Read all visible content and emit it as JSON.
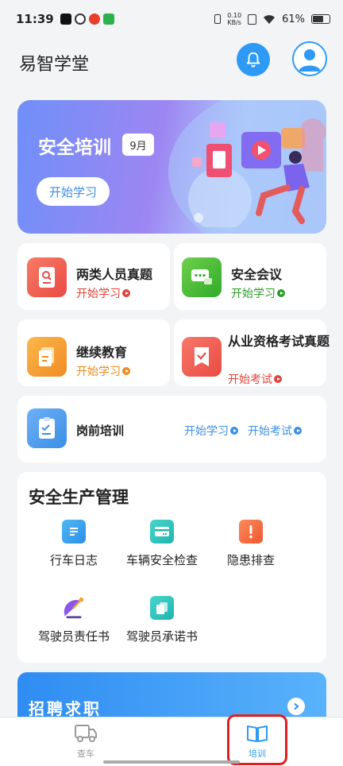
{
  "status_bar": {
    "time": "11:39",
    "net_speed_value": "0.10",
    "net_speed_unit": "KB/s",
    "battery": "61%"
  },
  "header": {
    "app_title": "易智学堂"
  },
  "banner": {
    "title": "安全培训",
    "month_badge": "9月",
    "button_label": "开始学习"
  },
  "cards": [
    {
      "title": "两类人员真题",
      "action": "开始学习",
      "color": "#f0574a"
    },
    {
      "title": "安全会议",
      "action": "开始学习",
      "color": "#3fb82c"
    },
    {
      "title": "继续教育",
      "action": "开始学习",
      "color": "#f59a2c"
    },
    {
      "title": "从业资格考试真题",
      "action": "开始考试",
      "color": "#ef5a4c"
    }
  ],
  "pre_job": {
    "title": "岗前培训",
    "action_study": "开始学习",
    "action_exam": "开始考试",
    "color": "#3a8fe6"
  },
  "safety_section": {
    "title": "安全生产管理",
    "tools": [
      {
        "label": "行车日志",
        "icon": "log-icon"
      },
      {
        "label": "车辆安全检查",
        "icon": "vehicle-check-icon"
      },
      {
        "label": "隐患排查",
        "icon": "hazard-icon"
      },
      {
        "label": "驾驶员责任书",
        "icon": "responsibility-icon"
      },
      {
        "label": "驾驶员承诺书",
        "icon": "pledge-icon"
      }
    ]
  },
  "recruit": {
    "title": "招聘求职"
  },
  "tabbar": {
    "tabs": [
      {
        "label": "查车"
      },
      {
        "label": "培训"
      }
    ]
  },
  "colors": {
    "accent": "#2e9af6",
    "highlight": "#e02020"
  }
}
